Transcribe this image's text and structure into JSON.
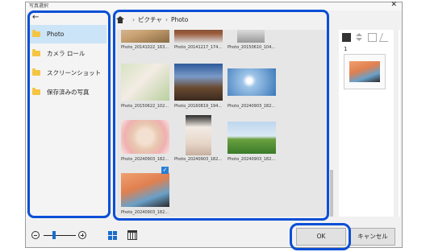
{
  "window": {
    "title": "写真選択",
    "close": "✕"
  },
  "sidebar": {
    "back": "←",
    "items": [
      {
        "label": "Photo",
        "selected": true
      },
      {
        "label": "カメラ ロール"
      },
      {
        "label": "スクリーンショット"
      },
      {
        "label": "保存済みの写真"
      }
    ]
  },
  "breadcrumb": {
    "parent": "ピクチャ",
    "current": "Photo",
    "sep": "›"
  },
  "photos": [
    {
      "caption": "Photo_20141022_163..."
    },
    {
      "caption": "Photo_20141217_174..."
    },
    {
      "caption": "Photo_20150610_104..."
    },
    {
      "caption": "Photo_20150622_102..."
    },
    {
      "caption": "Photo_20160819_194..."
    },
    {
      "caption": "Photo_20240903_182..."
    },
    {
      "caption": "Photo_20240903_182..."
    },
    {
      "caption": "Photo_20240903_182..."
    },
    {
      "caption": "Photo_20240903_182..."
    },
    {
      "caption": "Photo_20240903_182...",
      "checked": true
    }
  ],
  "preview": {
    "index": "1"
  },
  "buttons": {
    "ok": "OK",
    "cancel": "キャンセル"
  },
  "colors": {
    "highlight": "#0a4fd6",
    "accent": "#1a6dcc",
    "selected_bg": "#cce4f7"
  },
  "icons": [
    "back-arrow-icon",
    "folder-icon",
    "home-icon",
    "check-icon",
    "zoom-out-icon",
    "zoom-in-icon",
    "grid-view-icon",
    "calendar-view-icon"
  ]
}
